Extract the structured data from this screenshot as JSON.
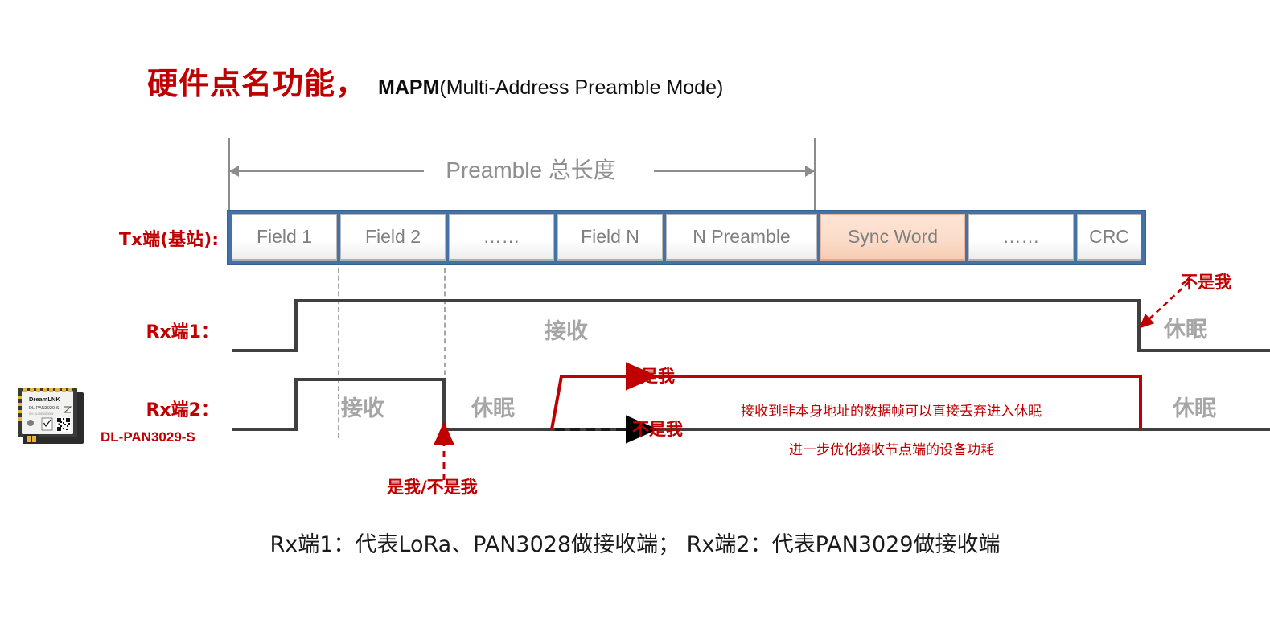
{
  "title": {
    "cn": "硬件点名功能，",
    "en_bold": "MAPM",
    "en_rest": "(Multi-Address Preamble Mode)"
  },
  "preamble": {
    "measure_label": "Preamble 总长度"
  },
  "rows": {
    "tx": {
      "label": "Tx端(基站):",
      "fields": [
        {
          "text": "Field 1",
          "kind": "normal"
        },
        {
          "text": "Field 2",
          "kind": "normal"
        },
        {
          "text": "……",
          "kind": "normal"
        },
        {
          "text": "Field N",
          "kind": "normal"
        },
        {
          "text": "N Preamble",
          "kind": "normal"
        },
        {
          "text": "Sync Word",
          "kind": "sync"
        },
        {
          "text": "……",
          "kind": "normal"
        },
        {
          "text": "CRC",
          "kind": "normal"
        }
      ]
    },
    "rx1": {
      "label": "Rx端1：",
      "state_receive": "接收",
      "state_sleep": "休眠",
      "callout_not_me": "不是我"
    },
    "rx2": {
      "label": "Rx端2：",
      "sublabel": "DL-PAN3029-S",
      "state_receive": "接收",
      "state_sleep_mid": "休眠",
      "state_sleep_end": "休眠",
      "callout_is_me": "是我",
      "callout_not_me": "不是我",
      "callout_decision": "是我/不是我",
      "note_line1": "接收到非本身地址的数据帧可以直接丢弃进入休眠",
      "note_line2": "进一步优化接收节点端的设备功耗"
    }
  },
  "caption": "Rx端1：代表LoRa、PAN3028做接收端；    Rx端2：代表PAN3029做接收端",
  "module": {
    "brand": "DreamLNK",
    "part": "DL-PAN3029-S",
    "serial": "SN: DL35E3300085"
  },
  "colors": {
    "title_red": "#c00000",
    "frame_blue": "#4472a8",
    "sync_fill": "#fbdcc9",
    "wire_gray": "#404040",
    "state_gray": "#a6a6a6",
    "measure_gray": "#8c8c8c"
  }
}
